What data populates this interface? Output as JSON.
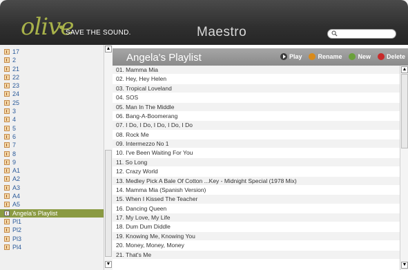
{
  "header": {
    "logo": "olive",
    "tagline": "SAVE THE SOUND.",
    "app_title": "Maestro",
    "search_placeholder": ""
  },
  "sidebar": {
    "items": [
      {
        "label": "17",
        "selected": false
      },
      {
        "label": "2",
        "selected": false
      },
      {
        "label": "21",
        "selected": false
      },
      {
        "label": "22",
        "selected": false
      },
      {
        "label": "23",
        "selected": false
      },
      {
        "label": "24",
        "selected": false
      },
      {
        "label": "25",
        "selected": false
      },
      {
        "label": "3",
        "selected": false
      },
      {
        "label": "4",
        "selected": false
      },
      {
        "label": "5",
        "selected": false
      },
      {
        "label": "6",
        "selected": false
      },
      {
        "label": "7",
        "selected": false
      },
      {
        "label": "8",
        "selected": false
      },
      {
        "label": "9",
        "selected": false
      },
      {
        "label": "A1",
        "selected": false
      },
      {
        "label": "A2",
        "selected": false
      },
      {
        "label": "A3",
        "selected": false
      },
      {
        "label": "A4",
        "selected": false
      },
      {
        "label": "A5",
        "selected": false
      },
      {
        "label": "Angela's Playlist",
        "selected": true
      },
      {
        "label": "Pl1",
        "selected": false
      },
      {
        "label": "Pl2",
        "selected": false
      },
      {
        "label": "Pl3",
        "selected": false
      },
      {
        "label": "Pl4",
        "selected": false
      }
    ]
  },
  "playlist": {
    "title": "Angela's Playlist",
    "actions": {
      "play": "Play",
      "rename": "Rename",
      "new": "New",
      "delete": "Delete"
    },
    "songs": [
      "01. Mamma Mia",
      "02. Hey, Hey Helen",
      "03. Tropical Loveland",
      "04. SOS",
      "05. Man In The Middle",
      "06. Bang-A-Boomerang",
      "07. I Do, I Do, I Do, I Do, I Do",
      "08. Rock Me",
      "09. Intermezzo No 1",
      "10. I've Been Waiting For You",
      "11. So Long",
      "12. Crazy World",
      "13. Medley Pick A Bale Of Cotton ...Key - Midnight Special (1978 Mix)",
      "14. Mamma Mia (Spanish Version)",
      "15. When I Kissed The Teacher",
      "16. Dancing Queen",
      "17. My Love, My Life",
      "18. Dum Dum Diddle",
      "19. Knowing Me, Knowing You",
      "20. Money, Money, Money",
      "21. That's Me"
    ]
  },
  "colors": {
    "accent": "#8a9a42",
    "logo": "#a8b24a",
    "header_bg": "#2f2f2f"
  }
}
